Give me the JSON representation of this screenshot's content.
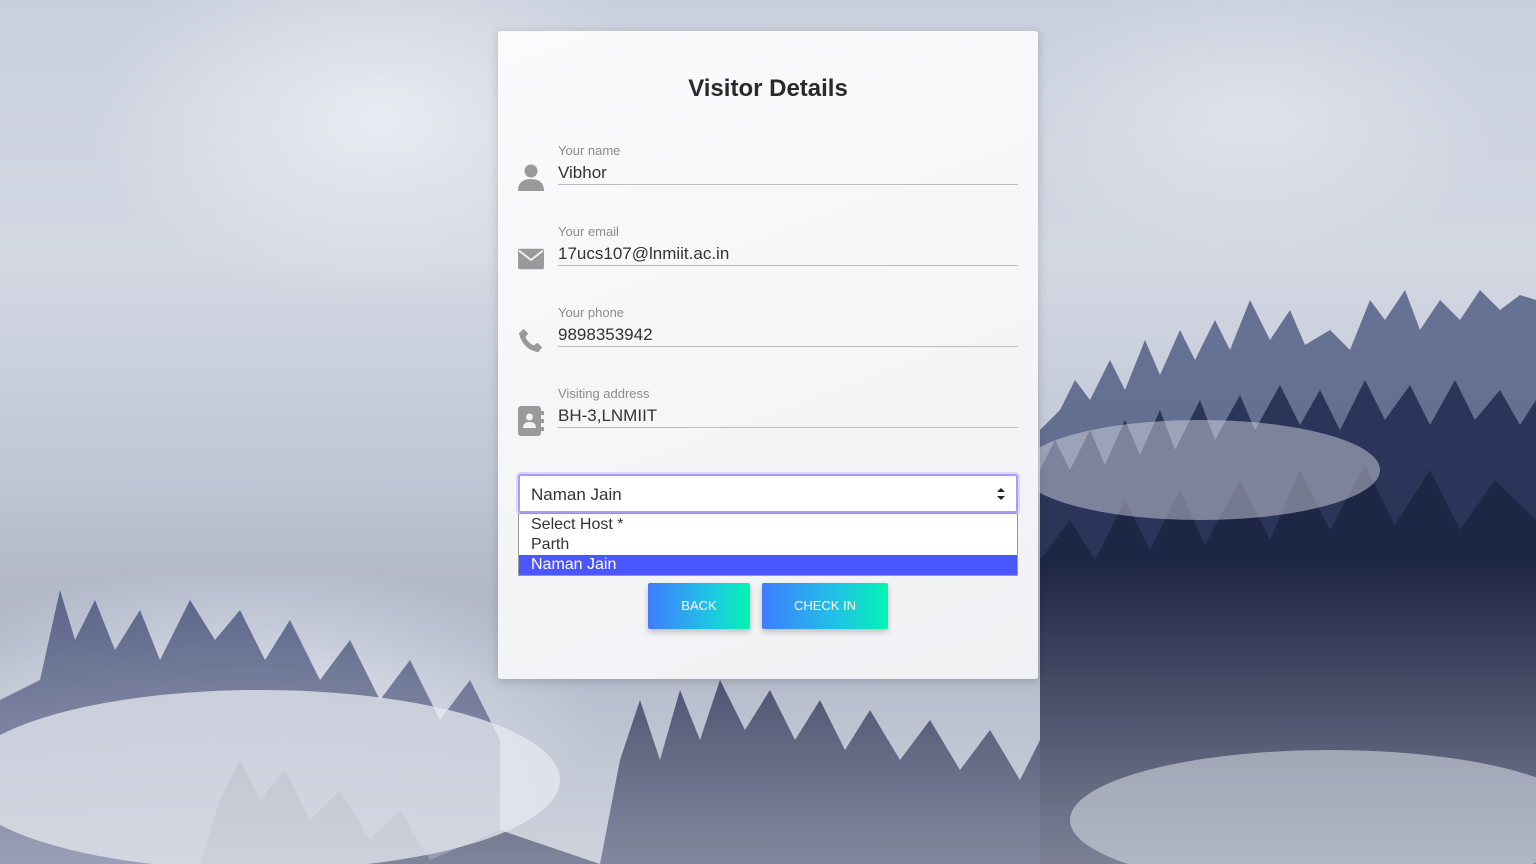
{
  "form": {
    "title": "Visitor Details",
    "fields": [
      {
        "label": "Your name",
        "value": "Vibhor",
        "icon": "user-icon"
      },
      {
        "label": "Your email",
        "value": "17ucs107@lnmiit.ac.in",
        "icon": "envelope-icon"
      },
      {
        "label": "Your phone",
        "value": "9898353942",
        "icon": "phone-icon"
      },
      {
        "label": "Visiting address",
        "value": "BH-3,LNMIIT",
        "icon": "address-book-icon"
      }
    ],
    "host_select": {
      "selected": "Naman Jain",
      "options": [
        "Select Host *",
        "Parth",
        "Naman Jain"
      ]
    },
    "buttons": {
      "back": "BACK",
      "check_in": "CHECK IN"
    }
  },
  "colors": {
    "accent_select_highlight": "#4a56ff",
    "button_gradient_start": "#3f7cff",
    "button_gradient_end": "#00f5b0",
    "focus_ring": "#a99dfc"
  }
}
